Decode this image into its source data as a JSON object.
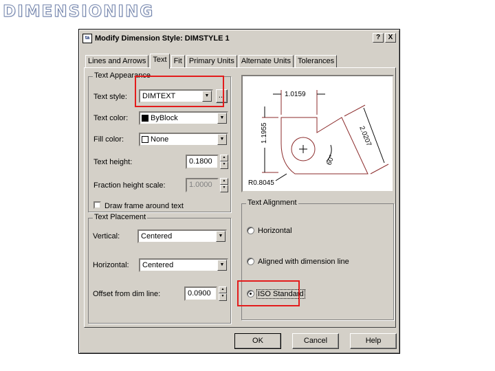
{
  "slide": {
    "title": "DIMENSIONING"
  },
  "dialog": {
    "icon_text": "ta",
    "title": "Modify Dimension Style: DIMSTYLE 1",
    "help_glyph": "?",
    "close_glyph": "X"
  },
  "tabs": [
    {
      "label": "Lines and Arrows"
    },
    {
      "label": "Text"
    },
    {
      "label": "Fit"
    },
    {
      "label": "Primary Units"
    },
    {
      "label": "Alternate Units"
    },
    {
      "label": "Tolerances"
    }
  ],
  "active_tab": "Text",
  "text_appearance": {
    "group_label": "Text Appearance",
    "text_style_label": "Text style:",
    "text_style_value": "DIMTEXT",
    "browse_label": "...",
    "text_color_label": "Text color:",
    "text_color_value": "ByBlock",
    "text_color_swatch": "#000000",
    "fill_color_label": "Fill color:",
    "fill_color_value": "None",
    "fill_color_swatch": "#ffffff",
    "text_height_label": "Text height:",
    "text_height_value": "0.1800",
    "fraction_scale_label": "Fraction height scale:",
    "fraction_scale_value": "1.0000",
    "draw_frame_label": "Draw frame around text",
    "draw_frame_checked": false
  },
  "text_placement": {
    "group_label": "Text Placement",
    "vertical_label": "Vertical:",
    "vertical_value": "Centered",
    "horizontal_label": "Horizontal:",
    "horizontal_value": "Centered",
    "offset_label": "Offset from dim line:",
    "offset_value": "0.0900"
  },
  "preview": {
    "dim_top": "1.0159",
    "dim_left": "1.1955",
    "dim_diag": "2.0207",
    "dim_angle": "60°",
    "dim_radius": "R0.8045"
  },
  "text_alignment": {
    "group_label": "Text Alignment",
    "options": [
      {
        "label": "Horizontal",
        "selected": false
      },
      {
        "label": "Aligned with dimension line",
        "selected": false
      },
      {
        "label": "ISO Standard",
        "selected": true
      }
    ]
  },
  "buttons": {
    "ok": "OK",
    "cancel": "Cancel",
    "help": "Help"
  },
  "colors": {
    "dialog_bg": "#d4d0c8",
    "highlight": "#e31b1b",
    "title_outline": "#6d7fa8",
    "preview_stroke": "#8b2a2a"
  }
}
